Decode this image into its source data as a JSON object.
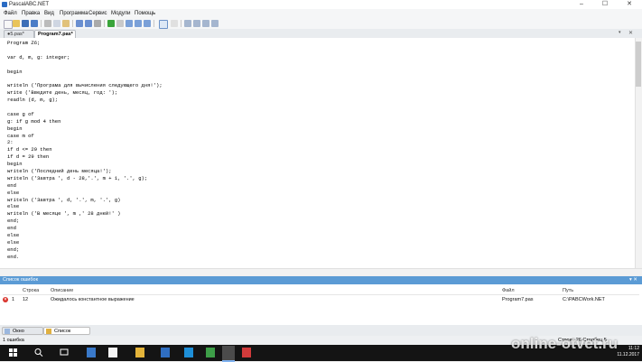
{
  "window": {
    "title": "PascalABC.NET"
  },
  "menu": [
    "Файл",
    "Правка",
    "Вид",
    "Программа",
    "Сервис",
    "Модули",
    "Помощь"
  ],
  "tabs": [
    {
      "label": "●5.pas*"
    },
    {
      "label": "Program7.pas*"
    }
  ],
  "code": [
    "Program Z6;",
    "",
    "var d, m, g: integer;",
    "",
    "begin",
    "",
    "writeln ('Програма для вычисления следующего дня!');",
    "write ('Введите день, месяц, год: ');",
    "readln (d, m, g);",
    "",
    "case g of",
    "g: if g mod 4 then",
    "begin",
    "case m of",
    "2:",
    "if d <= 29 then",
    "if d = 29 then",
    "begin",
    "writeln ('Последний день месяца!');",
    "writeln ('Завтра ', d - 28,'.', m + 1, '.', g);",
    "end",
    "else",
    "writeln ('Завтра ', d, '.', m, '.', g)",
    "else",
    "writeln ('В месяце ', m ,' 28 дней!' )",
    "end;",
    "end",
    "else",
    "else",
    "end;",
    "end."
  ],
  "error_list": {
    "title": "Список ошибок",
    "columns": {
      "line": "Строка",
      "description": "Описание",
      "file": "Файл",
      "path": "Путь"
    },
    "rows": [
      {
        "num": "1",
        "line": "12",
        "description": "Ожидалось константное выражение",
        "file": "Program7.pas",
        "path": "C:\\PABCWork.NET"
      }
    ]
  },
  "bottom_tabs": {
    "output": "Окно вывода",
    "errors": "Список ошибок"
  },
  "status": {
    "errors": "1 ошибка",
    "position": "Строка  26  Столбец  5"
  },
  "taskbar": {
    "time": "11:12",
    "date": "11.12.2017"
  },
  "watermark": "online-otvet.ru",
  "colors": {
    "error_header": "#5b9bd5",
    "error_icon": "#d9322b",
    "taskbar": "#141414"
  }
}
